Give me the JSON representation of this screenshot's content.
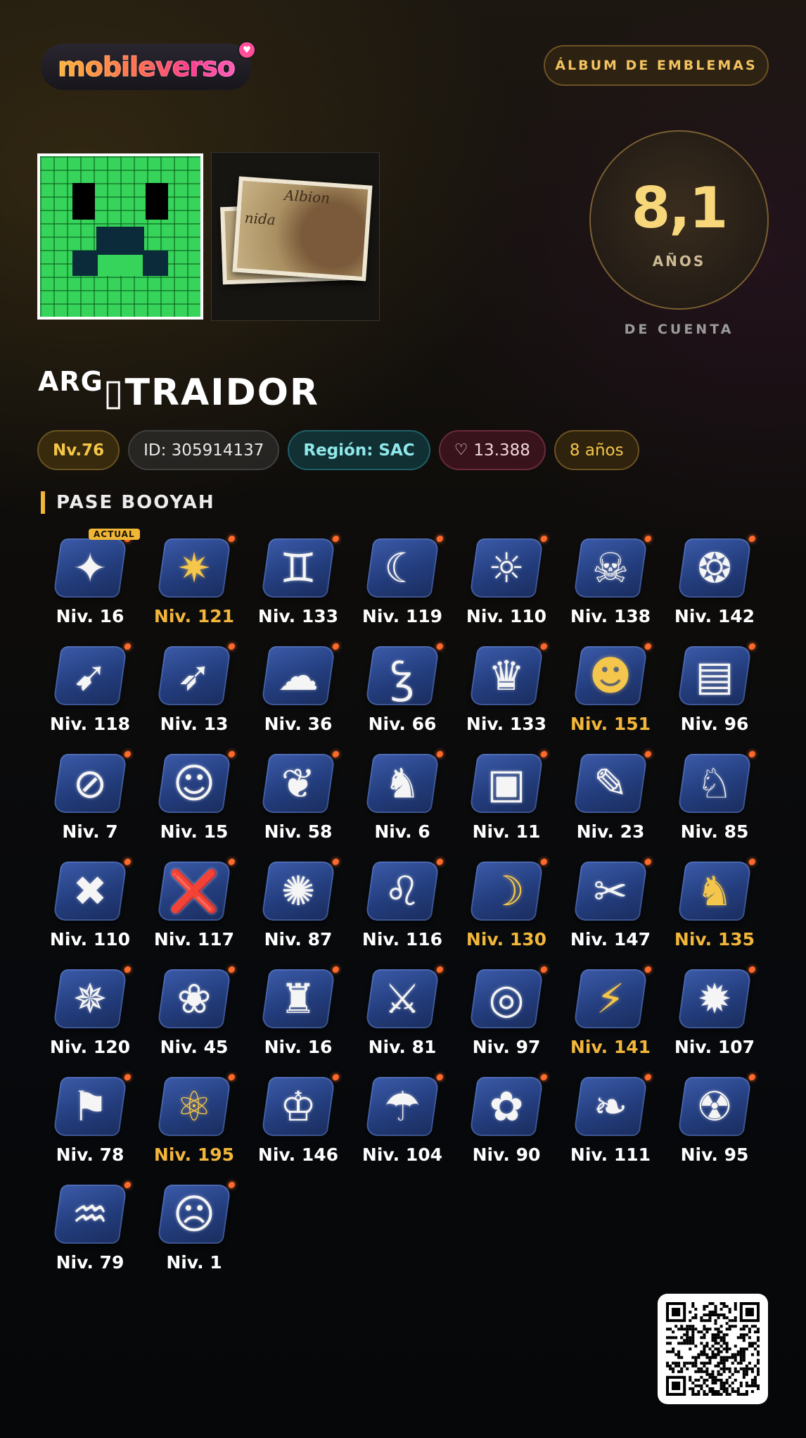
{
  "logo": {
    "text": "mobileverso",
    "heart": "♥"
  },
  "album_button": "ÁLBUM DE EMBLEMAS",
  "avatar": {
    "icon": "creeper-face-icon"
  },
  "banner": {
    "text_top": "Albion",
    "text_side": "nida"
  },
  "account_age": {
    "value": "8,1",
    "unit": "AÑOS",
    "caption": "DE CUENTA"
  },
  "player": {
    "clan_tag": "ARG",
    "glyph": "▯",
    "name": "TRAIDOR"
  },
  "badges": {
    "level": "Nv.76",
    "id": "ID: 305914137",
    "region": "Región: SAC",
    "likes": "13.388",
    "years": "8 años"
  },
  "colors": {
    "accent_gold": "#f2b63a",
    "emblem_blue": "#2f4c97",
    "region_teal": "#8fe8ea"
  },
  "section": {
    "title": "PASE BOOYAH",
    "current_tag": "ACTUAL"
  },
  "emblems": [
    {
      "label": "Niv. 16",
      "gold": false,
      "icon": "✦"
    },
    {
      "label": "Niv. 121",
      "gold": true,
      "icon": "✷"
    },
    {
      "label": "Niv. 133",
      "gold": false,
      "icon": "♊"
    },
    {
      "label": "Niv. 119",
      "gold": false,
      "icon": "☾"
    },
    {
      "label": "Niv. 110",
      "gold": false,
      "icon": "☼"
    },
    {
      "label": "Niv. 138",
      "gold": false,
      "icon": "☠"
    },
    {
      "label": "Niv. 142",
      "gold": false,
      "icon": "❂"
    },
    {
      "label": "Niv. 118",
      "gold": false,
      "icon": "➹"
    },
    {
      "label": "Niv. 13",
      "gold": false,
      "icon": "➶"
    },
    {
      "label": "Niv. 36",
      "gold": false,
      "icon": "☁"
    },
    {
      "label": "Niv. 66",
      "gold": false,
      "icon": "Ꝣ"
    },
    {
      "label": "Niv. 133",
      "gold": false,
      "icon": "♛"
    },
    {
      "label": "Niv. 151",
      "gold": true,
      "icon": "☻"
    },
    {
      "label": "Niv. 96",
      "gold": false,
      "icon": "▤"
    },
    {
      "label": "Niv. 7",
      "gold": false,
      "icon": "⊘"
    },
    {
      "label": "Niv. 15",
      "gold": false,
      "icon": "☺"
    },
    {
      "label": "Niv. 58",
      "gold": false,
      "icon": "❦"
    },
    {
      "label": "Niv. 6",
      "gold": false,
      "icon": "♞"
    },
    {
      "label": "Niv. 11",
      "gold": false,
      "icon": "▣"
    },
    {
      "label": "Niv. 23",
      "gold": false,
      "icon": "✎"
    },
    {
      "label": "Niv. 85",
      "gold": false,
      "icon": "♘"
    },
    {
      "label": "Niv. 110",
      "gold": false,
      "icon": "✖"
    },
    {
      "label": "Niv. 117",
      "gold": false,
      "icon": "❌"
    },
    {
      "label": "Niv. 87",
      "gold": false,
      "icon": "✺"
    },
    {
      "label": "Niv. 116",
      "gold": false,
      "icon": "♌"
    },
    {
      "label": "Niv. 130",
      "gold": true,
      "icon": "☽"
    },
    {
      "label": "Niv. 147",
      "gold": false,
      "icon": "✂"
    },
    {
      "label": "Niv. 135",
      "gold": true,
      "icon": "♞"
    },
    {
      "label": "Niv. 120",
      "gold": false,
      "icon": "✵"
    },
    {
      "label": "Niv. 45",
      "gold": false,
      "icon": "❀"
    },
    {
      "label": "Niv. 16",
      "gold": false,
      "icon": "♜"
    },
    {
      "label": "Niv. 81",
      "gold": false,
      "icon": "⚔"
    },
    {
      "label": "Niv. 97",
      "gold": false,
      "icon": "◎"
    },
    {
      "label": "Niv. 141",
      "gold": true,
      "icon": "⚡"
    },
    {
      "label": "Niv. 107",
      "gold": false,
      "icon": "✹"
    },
    {
      "label": "Niv. 78",
      "gold": false,
      "icon": "⚑"
    },
    {
      "label": "Niv. 195",
      "gold": true,
      "icon": "⚛"
    },
    {
      "label": "Niv. 146",
      "gold": false,
      "icon": "♔"
    },
    {
      "label": "Niv. 104",
      "gold": false,
      "icon": "☂"
    },
    {
      "label": "Niv. 90",
      "gold": false,
      "icon": "✿"
    },
    {
      "label": "Niv. 111",
      "gold": false,
      "icon": "❧"
    },
    {
      "label": "Niv. 95",
      "gold": false,
      "icon": "☢"
    },
    {
      "label": "Niv. 79",
      "gold": false,
      "icon": "♒"
    },
    {
      "label": "Niv. 1",
      "gold": false,
      "icon": "☹"
    }
  ],
  "qr": {
    "icon": "qr-code-icon"
  }
}
